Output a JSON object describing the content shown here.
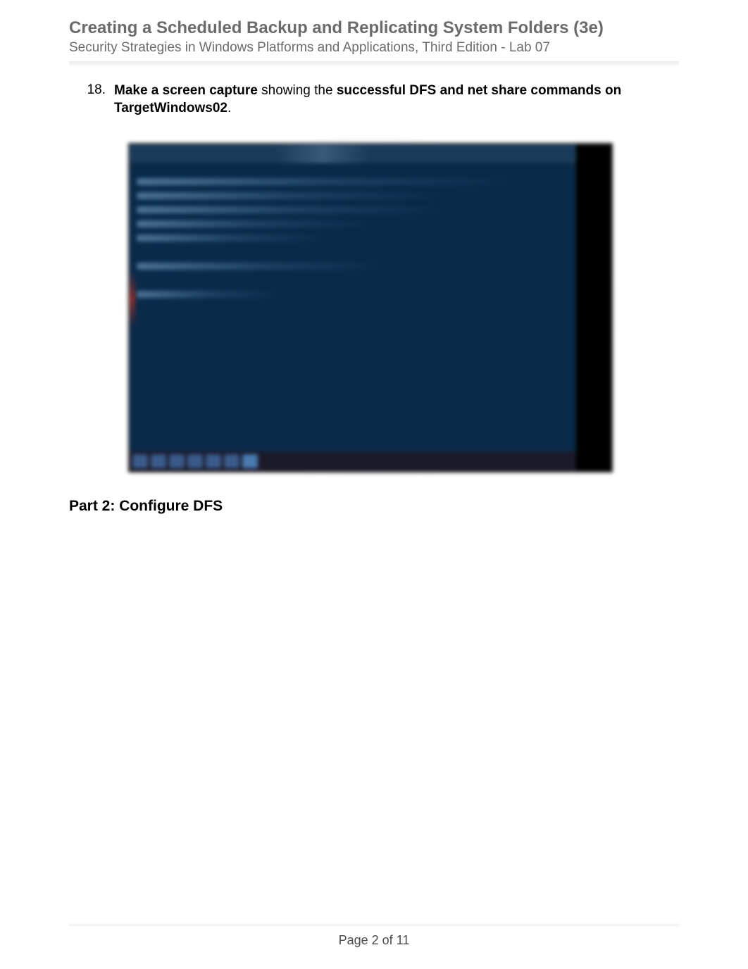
{
  "header": {
    "title": "Creating a Scheduled Backup and Replicating System Folders (3e)",
    "subtitle": "Security Strategies in Windows Platforms and Applications, Third Edition - Lab 07"
  },
  "instruction": {
    "number": "18.",
    "bold1": "Make a screen capture",
    "plain1": " showing the ",
    "bold2": "successful DFS and net share commands on TargetWindows02",
    "plain2": "."
  },
  "section": {
    "heading": "Part 2: Configure DFS"
  },
  "footer": {
    "page": "Page 2 of 11"
  }
}
